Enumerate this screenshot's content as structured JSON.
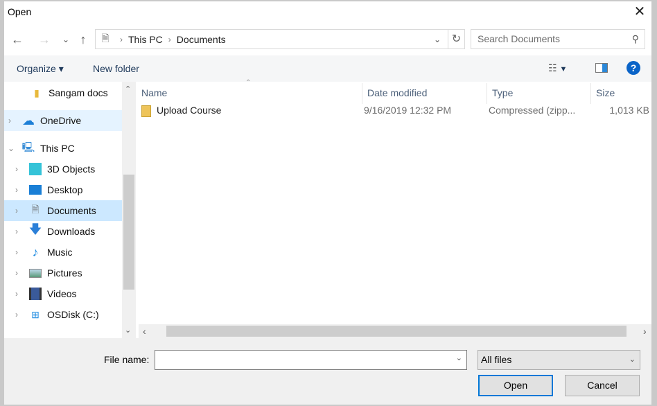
{
  "window": {
    "title": "Open"
  },
  "address": {
    "segments": [
      "This PC",
      "Documents"
    ]
  },
  "search": {
    "placeholder": "Search Documents"
  },
  "toolbar": {
    "organize": "Organize",
    "new_folder": "New folder"
  },
  "sidebar": {
    "items": [
      {
        "label": "Sangam docs",
        "icon": "folder-icon"
      },
      {
        "label": "OneDrive",
        "icon": "cloud-icon"
      },
      {
        "label": "This PC",
        "icon": "computer-icon"
      },
      {
        "label": "3D Objects",
        "icon": "cube-icon"
      },
      {
        "label": "Desktop",
        "icon": "desktop-icon"
      },
      {
        "label": "Documents",
        "icon": "document-icon",
        "selected": true
      },
      {
        "label": "Downloads",
        "icon": "download-icon"
      },
      {
        "label": "Music",
        "icon": "music-icon"
      },
      {
        "label": "Pictures",
        "icon": "pictures-icon"
      },
      {
        "label": "Videos",
        "icon": "videos-icon"
      },
      {
        "label": "OSDisk (C:)",
        "icon": "drive-icon"
      }
    ]
  },
  "columns": [
    "Name",
    "Date modified",
    "Type",
    "Size"
  ],
  "files": [
    {
      "name": "Upload Course",
      "date": "9/16/2019 12:32 PM",
      "type": "Compressed (zipp...",
      "size": "1,013 KB"
    }
  ],
  "bottom": {
    "file_name_label": "File name:",
    "file_name_value": "",
    "file_type": "All files",
    "open": "Open",
    "cancel": "Cancel"
  },
  "colors": {
    "accent": "#0078d7",
    "selection": "#cce8ff"
  }
}
